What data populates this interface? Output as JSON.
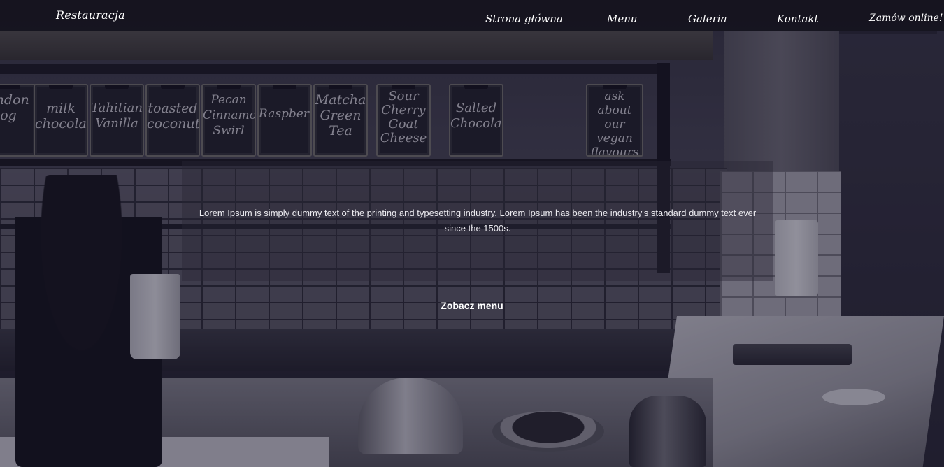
{
  "navbar": {
    "brand": "Restauracja",
    "links": [
      {
        "label": "Strona główna"
      },
      {
        "label": "Menu"
      },
      {
        "label": "Galeria"
      },
      {
        "label": "Kontakt"
      },
      {
        "label": "Zamów online!"
      }
    ]
  },
  "hero": {
    "intro_text": "Lorem Ipsum is simply dummy text of the printing and typesetting industry. Lorem Ipsum has been the industry's standard dummy text ever since the 1500s.",
    "cta_label": "Zobacz menu",
    "boards": [
      "ondon\nog",
      "milk\nchocolate",
      "Tahitian\nVanilla",
      "toasted\ncoconut",
      "Pecan\nCinnamon\nSwirl",
      "Raspberry",
      "Matcha\nGreen\nTea",
      "Sour\nCherry\nGoat\nCheese",
      "Salted\nChocolate",
      "ask about\nour\nvegan\nflavours"
    ]
  }
}
